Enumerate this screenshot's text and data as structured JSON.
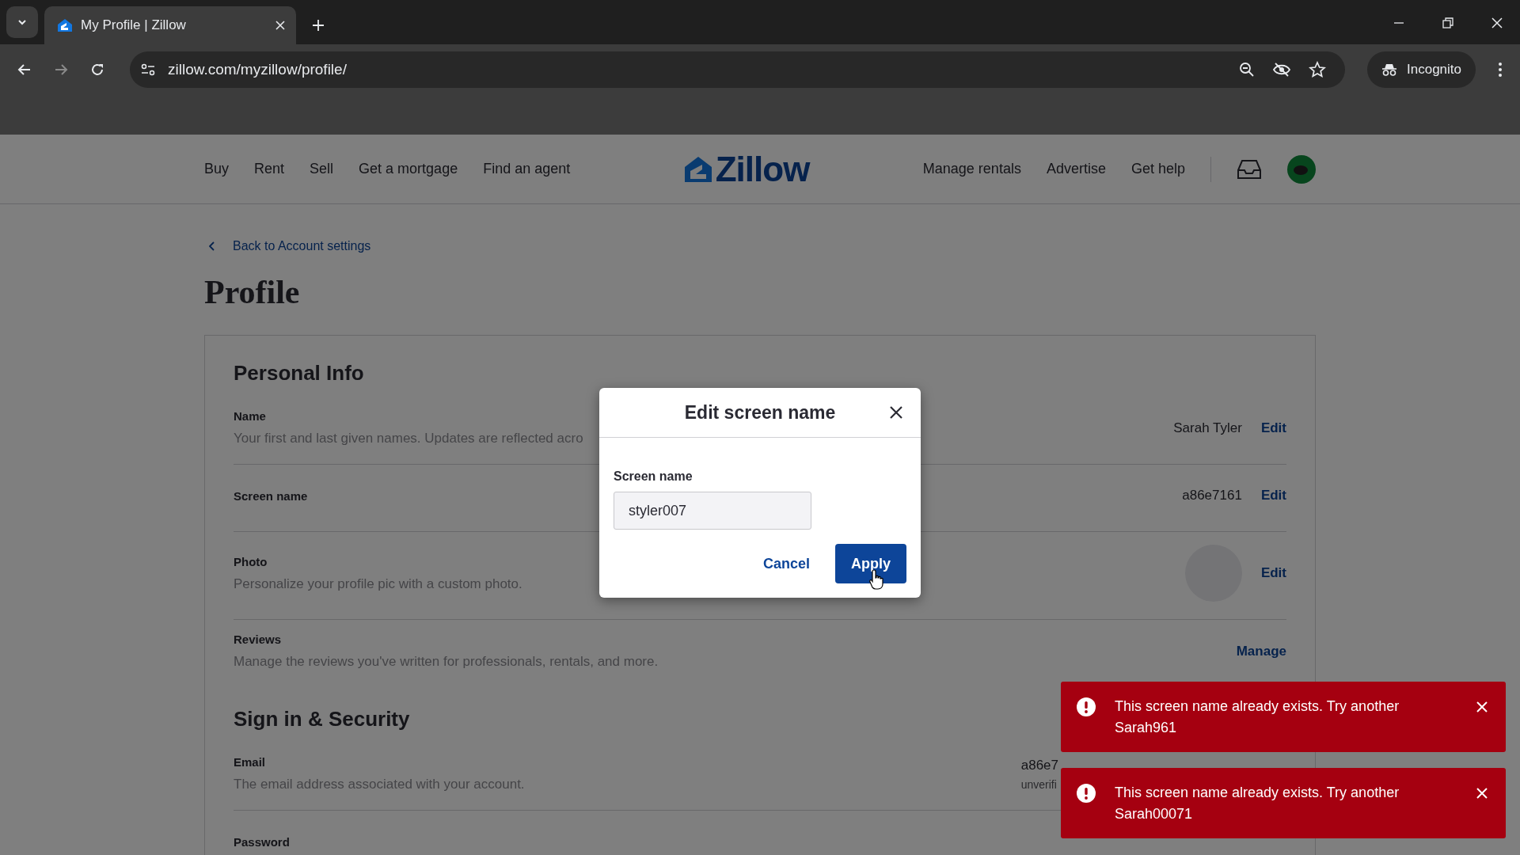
{
  "browser": {
    "tab_title": "My Profile | Zillow",
    "url": "zillow.com/myzillow/profile/",
    "profile_label": "Incognito"
  },
  "nav": {
    "left": [
      "Buy",
      "Rent",
      "Sell",
      "Get a mortgage",
      "Find an agent"
    ],
    "logo": "Zillow",
    "right": [
      "Manage rentals",
      "Advertise",
      "Get help"
    ]
  },
  "page": {
    "back_link": "Back to Account settings",
    "title": "Profile",
    "sections": [
      {
        "heading": "Personal Info",
        "rows": [
          {
            "kind": "text",
            "label": "Name",
            "description": "Your first and last given names. Updates are reflected acro",
            "value": "Sarah Tyler",
            "action": "Edit"
          },
          {
            "kind": "text",
            "label": "Screen name",
            "value": "a86e7161",
            "action": "Edit"
          },
          {
            "kind": "photo",
            "label": "Photo",
            "description": "Personalize your profile pic with a custom photo.",
            "action": "Edit"
          },
          {
            "kind": "text",
            "label": "Reviews",
            "description": "Manage the reviews you've written for professionals, rentals, and more.",
            "action": "Manage"
          }
        ]
      },
      {
        "heading": "Sign in & Security",
        "rows": [
          {
            "kind": "text",
            "label": "Email",
            "description": "The email address associated with your account.",
            "value": "a86e7",
            "note": "unverifi"
          },
          {
            "kind": "text",
            "label": "Password"
          }
        ]
      }
    ]
  },
  "dialog": {
    "title": "Edit screen name",
    "field_label": "Screen name",
    "value": "styler007",
    "cancel": "Cancel",
    "apply": "Apply"
  },
  "toasts": [
    {
      "message": "This screen name already exists. Try another",
      "suggestion": "Sarah961"
    },
    {
      "message": "This screen name already exists. Try another",
      "suggestion": "Sarah00071"
    }
  ]
}
